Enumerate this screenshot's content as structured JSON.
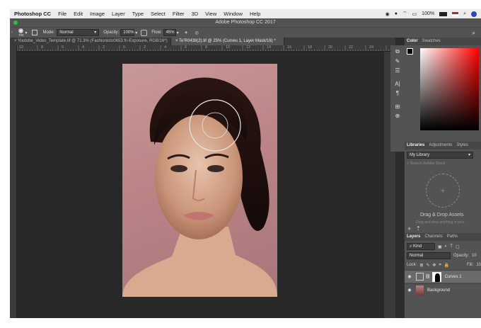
{
  "menubar": {
    "app": "Photoshop CC",
    "items": [
      "File",
      "Edit",
      "Image",
      "Layer",
      "Type",
      "Select",
      "Filter",
      "3D",
      "View",
      "Window",
      "Help"
    ],
    "battery": "100%",
    "battery_icon": "battery-icon"
  },
  "title": "Adobe Photoshop CC 2017",
  "options": {
    "brush_size": "700",
    "mode_label": "Mode:",
    "mode_value": "Normal",
    "opacity_label": "Opacity:",
    "opacity_value": "100%",
    "flow_label": "Flow:",
    "flow_value": "45%"
  },
  "tabs": [
    {
      "label": "Youtube_Video_Template.tif @ 71.3% (Fashionisto0653 fn-Exposure, RGB/16*)"
    },
    {
      "label": "Te'R0438(2).tif @ 25% (Curves 1, Layer Mask/16) *"
    }
  ],
  "ruler_ticks": [
    "10",
    "8",
    "6",
    "4",
    "2",
    "0",
    "2",
    "4",
    "6",
    "8",
    "10",
    "12",
    "14",
    "16",
    "18",
    "20",
    "22",
    "24"
  ],
  "panels": {
    "color_tabs": [
      "Color",
      "Swatches"
    ],
    "lib_tabs": [
      "Libraries",
      "Adjustments",
      "Styles"
    ],
    "library_name": "My Library",
    "search_placeholder": "Search Adobe Stock",
    "drop_title": "Drag & Drop Assets",
    "drop_sub": "Drag and drop anything in your",
    "layer_tabs": [
      "Layers",
      "Channels",
      "Paths"
    ],
    "kind_label": "Kind",
    "blend_mode": "Normal",
    "opacity_label": "Opacity:",
    "opacity_value": "10",
    "lock_label": "Lock:",
    "fill_label": "Fill:",
    "fill_value": "10",
    "layers": [
      {
        "name": "Curves 1"
      },
      {
        "name": "Background"
      }
    ]
  }
}
